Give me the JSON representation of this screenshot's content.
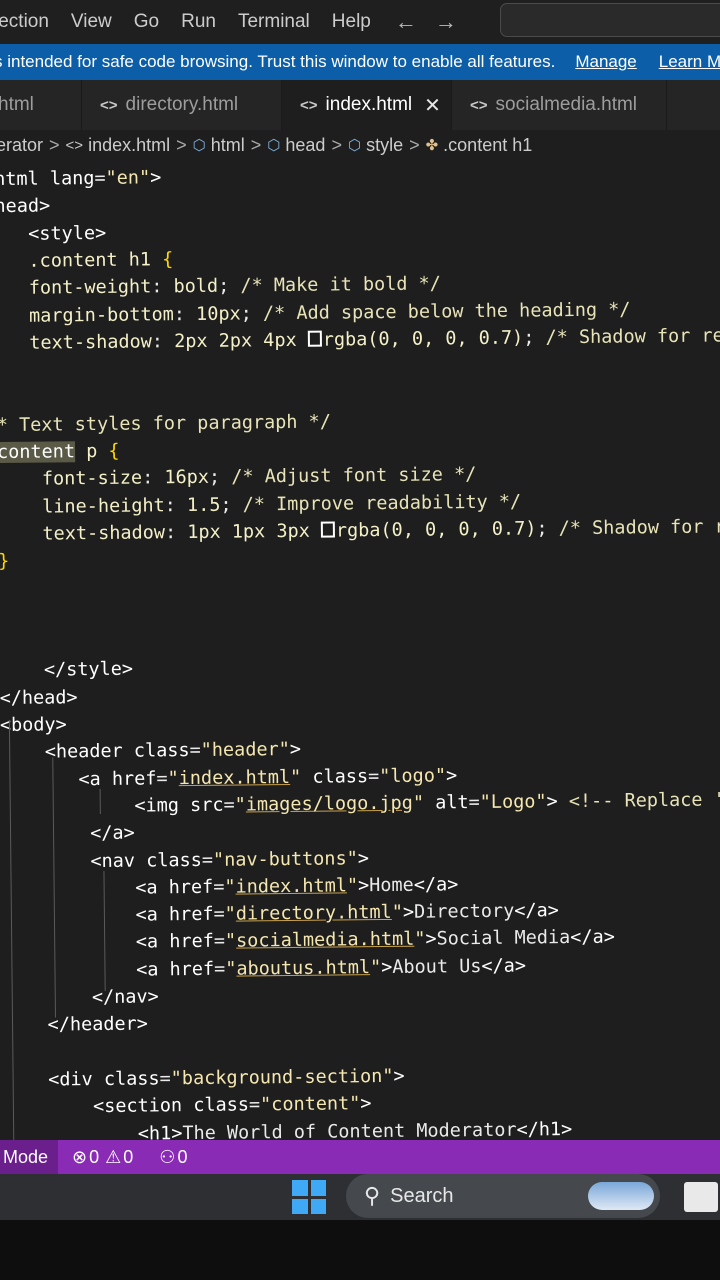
{
  "menubar": {
    "items": [
      "lection",
      "View",
      "Go",
      "Run",
      "Terminal",
      "Help"
    ],
    "nav_back": "←",
    "nav_forward": "→"
  },
  "banner": {
    "message": "s intended for safe code browsing. Trust this window to enable all features.",
    "manage": "Manage",
    "learn": "Learn M"
  },
  "tabs": [
    {
      "label": "html",
      "icon": ""
    },
    {
      "label": "directory.html",
      "icon": "<>"
    },
    {
      "label": "index.html",
      "icon": "<>",
      "active": true
    },
    {
      "label": "socialmedia.html",
      "icon": "<>"
    }
  ],
  "tab_close": "✕",
  "breadcrumb": [
    "erator",
    "index.html",
    "html",
    "head",
    "style",
    ".content h1"
  ],
  "code": [
    [
      [
        "tag",
        "ntml "
      ],
      [
        "attr",
        "lang"
      ],
      [
        "punct",
        "="
      ],
      [
        "str",
        "\"en\""
      ],
      [
        "tag",
        ">"
      ]
    ],
    [
      [
        "tag",
        "head>"
      ]
    ],
    [
      [
        "text",
        "   "
      ],
      [
        "tag",
        "<style>"
      ]
    ],
    [
      [
        "text",
        "   "
      ],
      [
        "sel",
        ".content h1 "
      ],
      [
        "brace",
        "{"
      ]
    ],
    [
      [
        "text",
        "   "
      ],
      [
        "prop",
        "font-weight"
      ],
      [
        "punct",
        ": "
      ],
      [
        "val",
        "bold"
      ],
      [
        "punct",
        "; "
      ],
      [
        "com",
        "/* Make it bold */"
      ]
    ],
    [
      [
        "text",
        "   "
      ],
      [
        "prop",
        "margin-bottom"
      ],
      [
        "punct",
        ": "
      ],
      [
        "val",
        "10px"
      ],
      [
        "punct",
        "; "
      ],
      [
        "com",
        "/* Add space below the heading */"
      ]
    ],
    [
      [
        "text",
        "   "
      ],
      [
        "prop",
        "text-shadow"
      ],
      [
        "punct",
        ": "
      ],
      [
        "val",
        "2px 2px 4px "
      ],
      [
        "swatch",
        ""
      ],
      [
        "val",
        "rgba(0, 0, 0, 0.7)"
      ],
      [
        "punct",
        "; "
      ],
      [
        "com",
        "/* Shadow for re"
      ]
    ],
    [],
    [],
    [
      [
        "com",
        "* Text styles for paragraph */"
      ]
    ],
    [
      [
        "hl",
        "content"
      ],
      [
        "sel",
        " p "
      ],
      [
        "brace",
        "{"
      ]
    ],
    [
      [
        "text",
        "    "
      ],
      [
        "prop",
        "font-size"
      ],
      [
        "punct",
        ": "
      ],
      [
        "val",
        "16px"
      ],
      [
        "punct",
        "; "
      ],
      [
        "com",
        "/* Adjust font size */"
      ]
    ],
    [
      [
        "text",
        "    "
      ],
      [
        "prop",
        "line-height"
      ],
      [
        "punct",
        ": "
      ],
      [
        "val",
        "1.5"
      ],
      [
        "punct",
        "; "
      ],
      [
        "com",
        "/* Improve readability */"
      ]
    ],
    [
      [
        "text",
        "    "
      ],
      [
        "prop",
        "text-shadow"
      ],
      [
        "punct",
        ": "
      ],
      [
        "val",
        "1px 1px 3px "
      ],
      [
        "swatch",
        ""
      ],
      [
        "val",
        "rgba(0, 0, 0, 0.7)"
      ],
      [
        "punct",
        "; "
      ],
      [
        "com",
        "/* Shadow for re"
      ]
    ],
    [
      [
        "brace",
        "}"
      ]
    ],
    [],
    [],
    [],
    [
      [
        "text",
        "    "
      ],
      [
        "tag",
        "</style>"
      ]
    ],
    [
      [
        "tag",
        "</head>"
      ]
    ],
    [
      [
        "tag",
        "<body>"
      ]
    ],
    [
      [
        "text",
        "    "
      ],
      [
        "tag",
        "<header "
      ],
      [
        "attr",
        "class"
      ],
      [
        "punct",
        "="
      ],
      [
        "str",
        "\"header\""
      ],
      [
        "tag",
        ">"
      ]
    ],
    [
      [
        "text",
        "       "
      ],
      [
        "tag",
        "<a "
      ],
      [
        "attr",
        "href"
      ],
      [
        "punct",
        "="
      ],
      [
        "str",
        "\""
      ],
      [
        "link",
        "index.html"
      ],
      [
        "str",
        "\""
      ],
      [
        "attr",
        " class"
      ],
      [
        "punct",
        "="
      ],
      [
        "str",
        "\"logo\""
      ],
      [
        "tag",
        ">"
      ]
    ],
    [
      [
        "text",
        "            "
      ],
      [
        "tag",
        "<img "
      ],
      [
        "attr",
        "src"
      ],
      [
        "punct",
        "="
      ],
      [
        "str",
        "\""
      ],
      [
        "link",
        "images/logo.jpg"
      ],
      [
        "str",
        "\""
      ],
      [
        "attr",
        " alt"
      ],
      [
        "punct",
        "="
      ],
      [
        "str",
        "\"Logo\""
      ],
      [
        "tag",
        "> "
      ],
      [
        "com",
        "<!-- Replace '"
      ]
    ],
    [
      [
        "text",
        "        "
      ],
      [
        "tag",
        "</a>"
      ]
    ],
    [
      [
        "text",
        "        "
      ],
      [
        "tag",
        "<nav "
      ],
      [
        "attr",
        "class"
      ],
      [
        "punct",
        "="
      ],
      [
        "str",
        "\"nav-buttons\""
      ],
      [
        "tag",
        ">"
      ]
    ],
    [
      [
        "text",
        "            "
      ],
      [
        "tag",
        "<a "
      ],
      [
        "attr",
        "href"
      ],
      [
        "punct",
        "="
      ],
      [
        "str",
        "\""
      ],
      [
        "link",
        "index.html"
      ],
      [
        "str",
        "\""
      ],
      [
        "tag",
        ">"
      ],
      [
        "text",
        "Home"
      ],
      [
        "tag",
        "</a>"
      ]
    ],
    [
      [
        "text",
        "            "
      ],
      [
        "tag",
        "<a "
      ],
      [
        "attr",
        "href"
      ],
      [
        "punct",
        "="
      ],
      [
        "str",
        "\""
      ],
      [
        "link",
        "directory.html"
      ],
      [
        "str",
        "\""
      ],
      [
        "tag",
        ">"
      ],
      [
        "text",
        "Directory"
      ],
      [
        "tag",
        "</a>"
      ]
    ],
    [
      [
        "text",
        "            "
      ],
      [
        "tag",
        "<a "
      ],
      [
        "attr",
        "href"
      ],
      [
        "punct",
        "="
      ],
      [
        "str",
        "\""
      ],
      [
        "link",
        "socialmedia.html"
      ],
      [
        "str",
        "\""
      ],
      [
        "tag",
        ">"
      ],
      [
        "text",
        "Social Media"
      ],
      [
        "tag",
        "</a>"
      ]
    ],
    [
      [
        "text",
        "            "
      ],
      [
        "tag",
        "<a "
      ],
      [
        "attr",
        "href"
      ],
      [
        "punct",
        "="
      ],
      [
        "str",
        "\""
      ],
      [
        "link",
        "aboutus.html"
      ],
      [
        "str",
        "\""
      ],
      [
        "tag",
        ">"
      ],
      [
        "text",
        "About Us"
      ],
      [
        "tag",
        "</a>"
      ]
    ],
    [
      [
        "text",
        "        "
      ],
      [
        "tag",
        "</nav>"
      ]
    ],
    [
      [
        "text",
        "    "
      ],
      [
        "tag",
        "</header>"
      ]
    ],
    [],
    [
      [
        "text",
        "    "
      ],
      [
        "tag",
        "<div "
      ],
      [
        "attr",
        "class"
      ],
      [
        "punct",
        "="
      ],
      [
        "str",
        "\"background-section\""
      ],
      [
        "tag",
        ">"
      ]
    ],
    [
      [
        "text",
        "        "
      ],
      [
        "tag",
        "<section "
      ],
      [
        "attr",
        "class"
      ],
      [
        "punct",
        "="
      ],
      [
        "str",
        "\"content\""
      ],
      [
        "tag",
        ">"
      ]
    ],
    [
      [
        "text",
        "            "
      ],
      [
        "tag",
        "<h1>"
      ],
      [
        "text",
        "The World of Content Moderator"
      ],
      [
        "tag",
        "</h1>"
      ]
    ]
  ],
  "statusbar": {
    "mode": "l Mode",
    "errors": "0",
    "warnings": "0",
    "ports": "0"
  },
  "taskbar": {
    "search_placeholder": "Search"
  }
}
